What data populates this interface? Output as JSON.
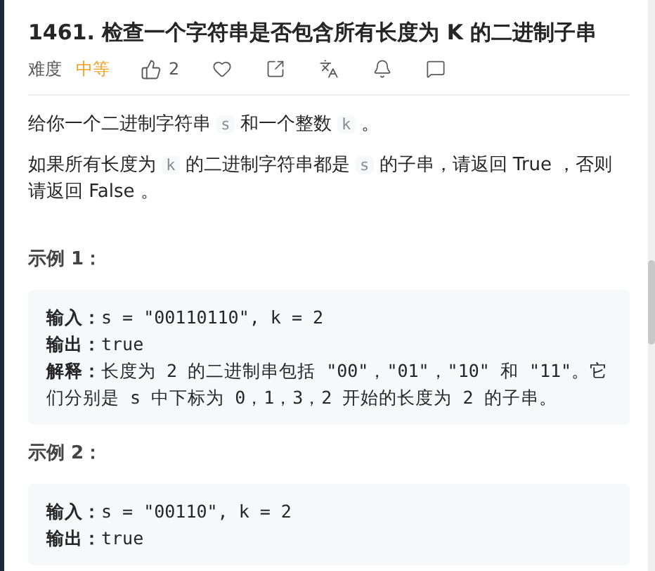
{
  "title": "1461. 检查一个字符串是否包含所有长度为 K 的二进制子串",
  "meta": {
    "difficulty_label": "难度",
    "difficulty": "中等",
    "likes": "2"
  },
  "description": [
    [
      {
        "kind": "text",
        "text": "给你一个二进制字符串 "
      },
      {
        "kind": "code",
        "text": "s"
      },
      {
        "kind": "text",
        "text": " 和一个整数 "
      },
      {
        "kind": "code",
        "text": "k"
      },
      {
        "kind": "text",
        "text": " 。"
      }
    ],
    [
      {
        "kind": "text",
        "text": "如果所有长度为 "
      },
      {
        "kind": "code",
        "text": "k"
      },
      {
        "kind": "text",
        "text": " 的二进制字符串都是 "
      },
      {
        "kind": "code",
        "text": "s"
      },
      {
        "kind": "text",
        "text": " 的子串，请返回 True ，否则请返回 False 。"
      }
    ]
  ],
  "examples": [
    {
      "heading": "示例 1：",
      "lines": [
        {
          "label": "输入：",
          "value": "s = \"00110110\", k = 2"
        },
        {
          "label": "输出：",
          "value": "true"
        },
        {
          "label": "解释：",
          "value": "长度为 2 的二进制串包括 \"00\"，\"01\"，\"10\" 和 \"11\"。它们分别是 s 中下标为 0，1，3，2 开始的长度为 2 的子串。"
        }
      ]
    },
    {
      "heading": "示例 2：",
      "lines": [
        {
          "label": "输入：",
          "value": "s = \"00110\", k = 2"
        },
        {
          "label": "输出：",
          "value": "true"
        }
      ]
    }
  ]
}
